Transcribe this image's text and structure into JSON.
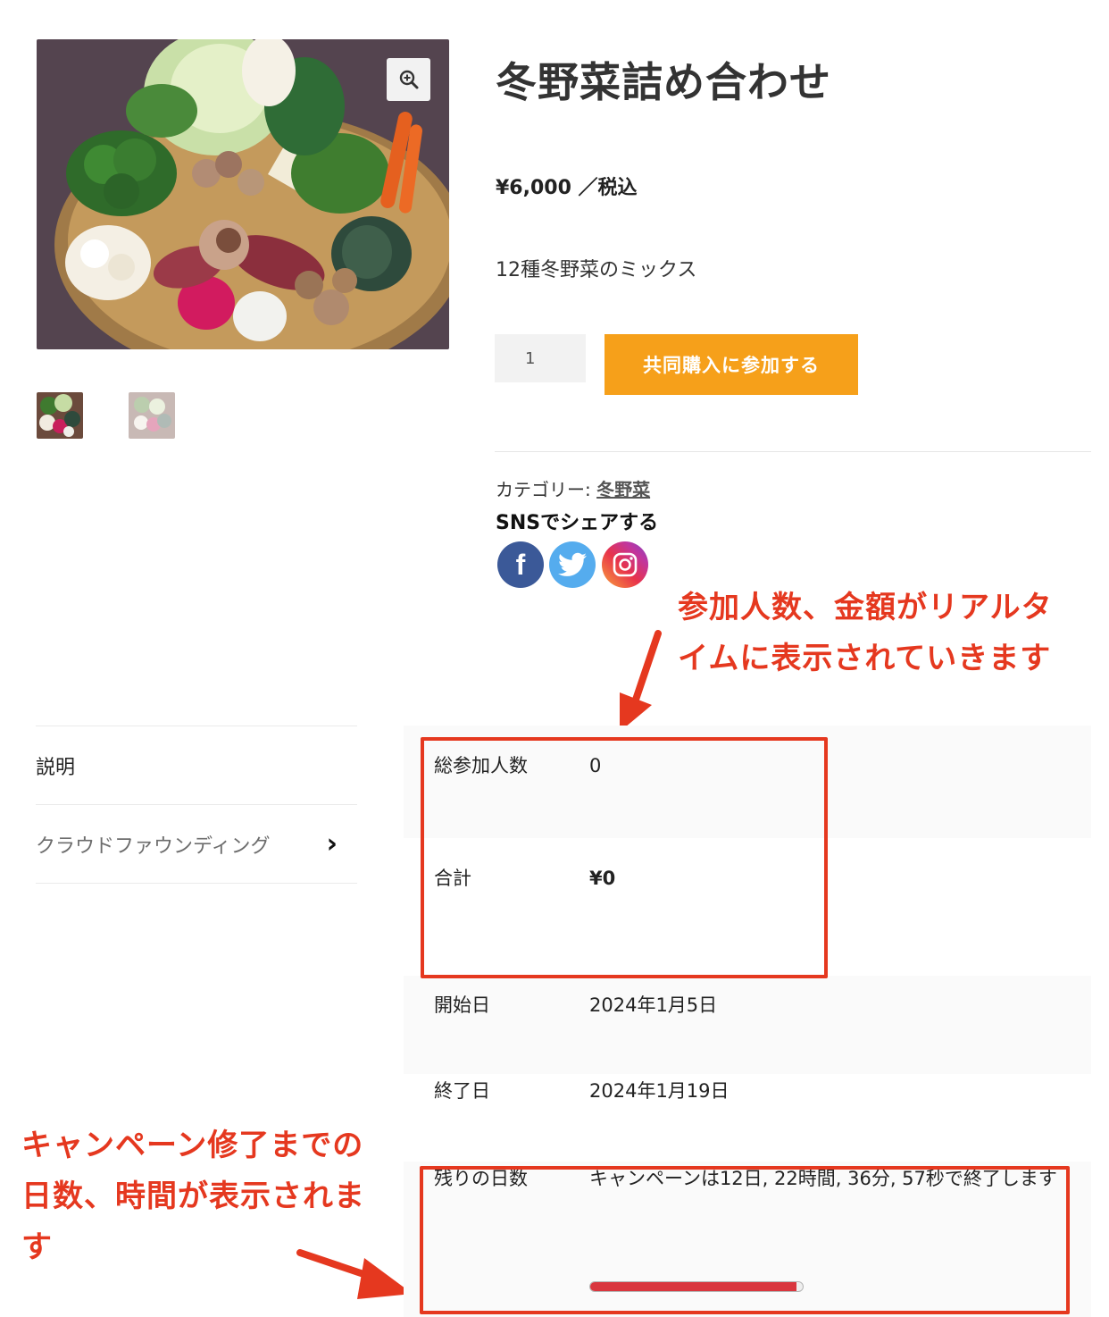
{
  "product": {
    "title": "冬野菜詰め合わせ",
    "price": "¥6,000 ／税込",
    "short_description": "12種冬野菜のミックス",
    "quantity": "1",
    "add_to_cart_label": "共同購入に参加する",
    "category_label": "カテゴリー: ",
    "category_link": "冬野菜"
  },
  "gallery": {
    "zoom_icon": "zoom-in-icon",
    "thumbnail_count": 2
  },
  "share": {
    "title": "SNSでシェアする",
    "icons": [
      "facebook-icon",
      "twitter-icon",
      "instagram-icon"
    ],
    "facebook_glyph": "f"
  },
  "annotations": {
    "top": "参加人数、金額がリアルタイムに表示されていきます",
    "bottom": "キャンペーン修了までの日数、時間が表示されます"
  },
  "tabs": [
    {
      "label": "説明",
      "active": true
    },
    {
      "label": "クラウドファウンディング",
      "active": false,
      "chevron": "›"
    }
  ],
  "crowdfunding": {
    "participants_label": "総参加人数",
    "participants_value": "0",
    "total_label": "合計",
    "total_value": "¥0",
    "funding_progress": 0,
    "start_label": "開始日",
    "start_value": "2024年1月5日",
    "end_label": "終了日",
    "end_value": "2024年1月19日",
    "remaining_label": "残りの日数",
    "remaining_value": "キャンペーンは12日, 22時間, 36分, 57秒で終了します",
    "time_progress": 0.97
  },
  "colors": {
    "accent_button": "#f6a01a",
    "annotation_red": "#e5381f",
    "progress_red": "#d9363e"
  }
}
